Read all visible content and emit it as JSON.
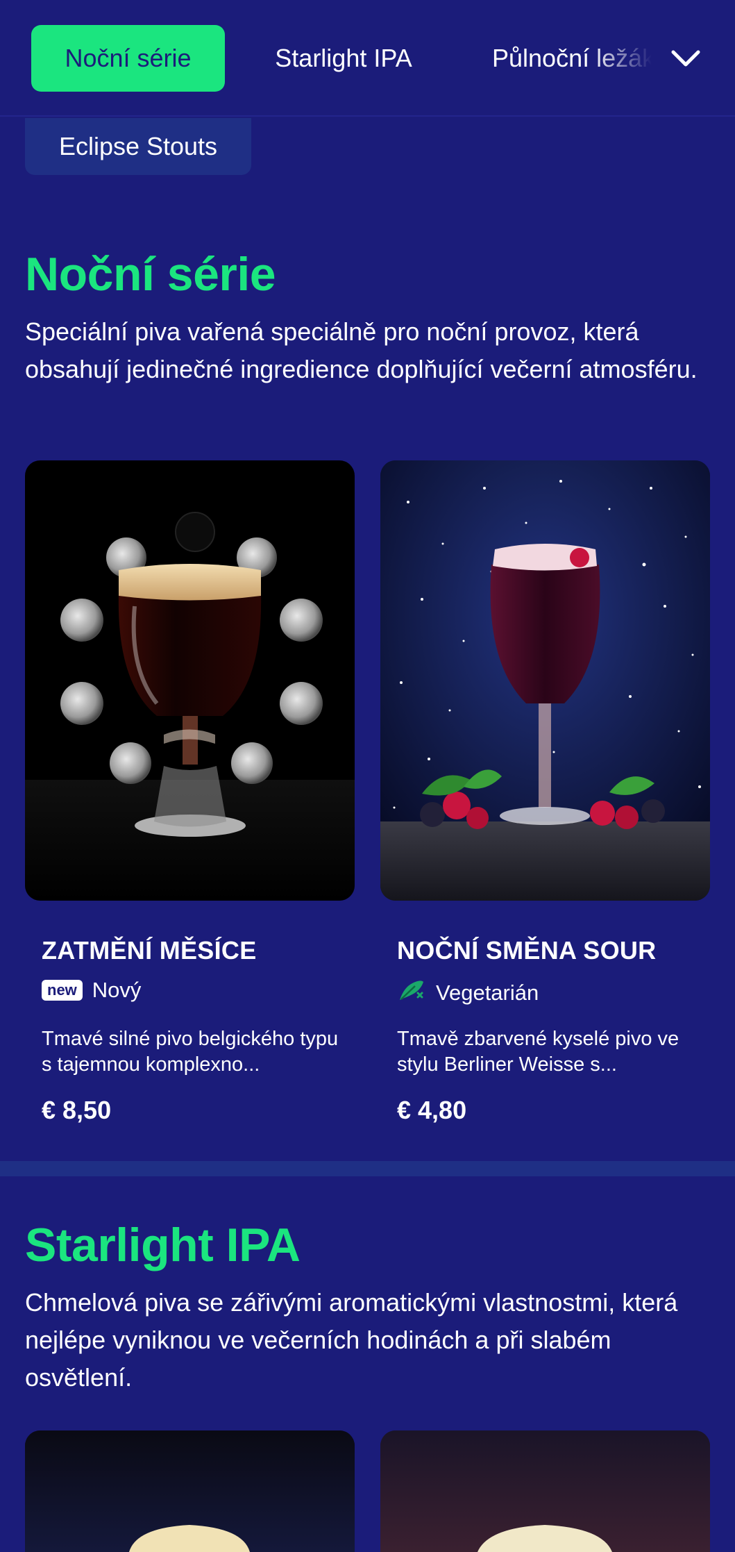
{
  "nav": {
    "tabs": [
      {
        "label": "Noční série",
        "active": true
      },
      {
        "label": "Starlight IPA",
        "active": false
      },
      {
        "label": "Půlnoční ležáky",
        "active": false
      },
      {
        "label": "Eclipse Stouts",
        "active": false
      }
    ],
    "expand_icon": "chevron-down-icon"
  },
  "sections": [
    {
      "title": "Noční série",
      "description": "Speciální piva vařená speciálně pro noční provoz, která obsahují jedinečné ingredience doplňující večerní atmosféru.",
      "products": [
        {
          "name": "ZATMĚNÍ MĚSÍCE",
          "badge_icon": "new",
          "badge_label": "Nový",
          "description": "Tmavé silné pivo belgického typu s tajemnou komplexno...",
          "price": "€ 8,50"
        },
        {
          "name": "NOČNÍ SMĚNA SOUR",
          "badge_icon": "leaf-icon",
          "badge_label": "Vegetarián",
          "description": "Tmavě zbarvené kyselé pivo ve stylu Berliner Weisse s...",
          "price": "€ 4,80"
        }
      ]
    },
    {
      "title": "Starlight IPA",
      "description": "Chmelová piva se zářivými aromatickými vlastnostmi, která nejlépe vyniknou ve večerních hodinách a při slabém osvětlení."
    }
  ],
  "colors": {
    "background": "#1b1c7a",
    "accent": "#1be57f",
    "card_bg": "#1f2f85"
  }
}
